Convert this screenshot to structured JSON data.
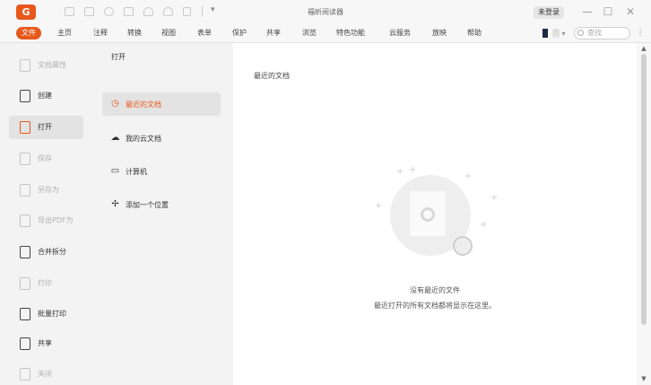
{
  "app": {
    "title": "福昕阅读器",
    "logo_letter": "G",
    "brand_color": "#e8571b"
  },
  "titlebar": {
    "login_label": "未登录",
    "minimize_symbol": "—",
    "maximize_symbol": "☐",
    "close_symbol": "✕",
    "qa_dropdown_symbol": "▾"
  },
  "menu": {
    "items": [
      "文件",
      "主页",
      "注释",
      "转换",
      "视图",
      "表单",
      "保护",
      "共享",
      "浏览",
      "特色功能",
      "云服务",
      "放映",
      "帮助"
    ],
    "active_index": 0,
    "mode_switch_label": "🗐 ▾",
    "search_placeholder": "查找",
    "more_symbol": "⋮"
  },
  "leftnav": {
    "items": [
      {
        "label": "文档属性",
        "disabled": true
      },
      {
        "label": "创建",
        "disabled": false
      },
      {
        "label": "打开",
        "disabled": false,
        "active": true
      },
      {
        "label": "保存",
        "disabled": true
      },
      {
        "label": "另存为",
        "disabled": true
      },
      {
        "label": "导出PDF为",
        "disabled": true
      },
      {
        "label": "合并拆分",
        "disabled": false
      },
      {
        "label": "打印",
        "disabled": true
      },
      {
        "label": "批量打印",
        "disabled": false
      },
      {
        "label": "共享",
        "disabled": false
      },
      {
        "label": "关闭",
        "disabled": true
      }
    ]
  },
  "open_panel": {
    "title": "打开",
    "locations": [
      {
        "label": "最近的文档",
        "icon": "clock-icon",
        "symbol": "◷",
        "active": true
      },
      {
        "label": "我的云文档",
        "icon": "cloud-icon",
        "symbol": "☁"
      },
      {
        "label": "计算机",
        "icon": "computer-icon",
        "symbol": "▭"
      },
      {
        "label": "添加一个位置",
        "icon": "add-location-icon",
        "symbol": "✢"
      }
    ]
  },
  "main": {
    "section_title": "最近的文档",
    "empty_title": "没有最近的文件",
    "empty_subtitle": "最近打开的所有文档都将显示在这里。"
  },
  "scrollbar": {
    "up_symbol": "▲",
    "down_symbol": "▼"
  }
}
